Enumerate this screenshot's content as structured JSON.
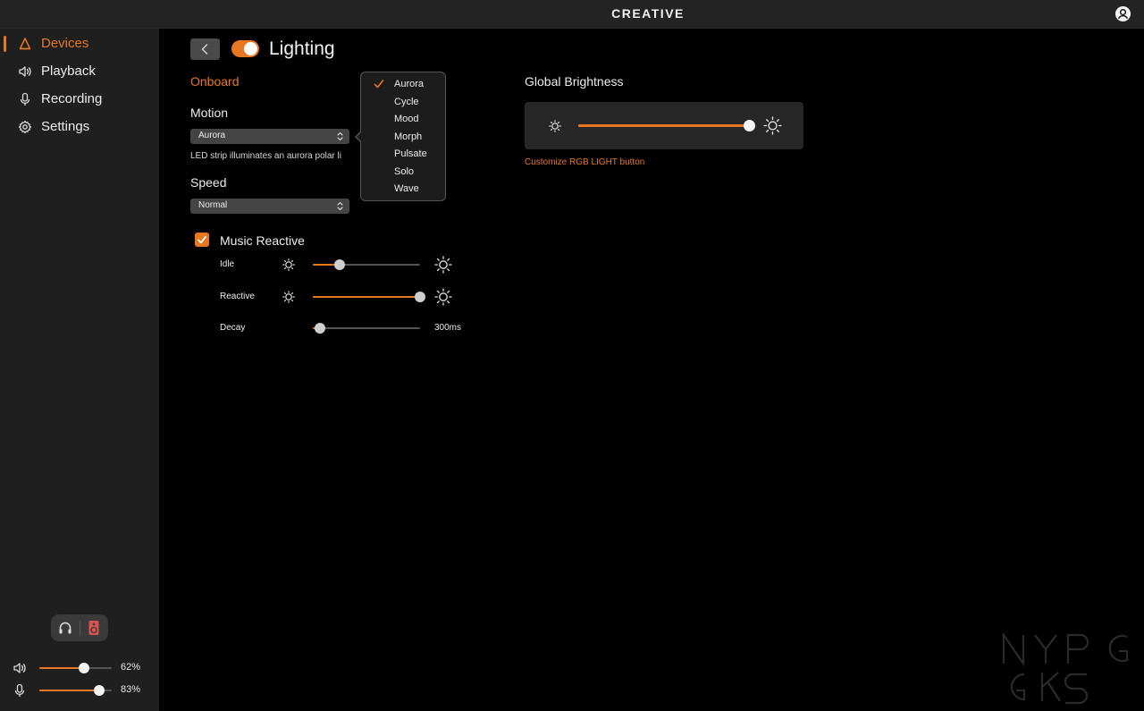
{
  "header": {
    "brand": "CREATIVE",
    "account_icon": "user-circle-icon"
  },
  "sidebar": {
    "items": [
      {
        "label": "Devices",
        "icon": "device-triangle-icon",
        "active": true
      },
      {
        "label": "Playback",
        "icon": "speaker-icon",
        "active": false
      },
      {
        "label": "Recording",
        "icon": "microphone-icon",
        "active": false
      },
      {
        "label": "Settings",
        "icon": "gear-icon",
        "active": false
      }
    ],
    "output_toggle": {
      "options": [
        "headphones-icon",
        "speaker-box-icon"
      ]
    },
    "volume": {
      "speaker": {
        "value": 62,
        "label": "62%"
      },
      "mic": {
        "value": 83,
        "label": "83%"
      }
    }
  },
  "main": {
    "title": "Lighting",
    "enabled": true,
    "section": "Onboard",
    "motion": {
      "label": "Motion",
      "selected": "Aurora",
      "description": "LED strip illuminates an aurora polar li",
      "options": [
        "Aurora",
        "Cycle",
        "Mood",
        "Morph",
        "Pulsate",
        "Solo",
        "Wave"
      ]
    },
    "speed": {
      "label": "Speed",
      "selected": "Normal"
    },
    "music_reactive": {
      "label": "Music Reactive",
      "checked": true,
      "idle": {
        "label": "Idle",
        "value": 0.25
      },
      "reactive": {
        "label": "Reactive",
        "value": 1.0
      },
      "decay": {
        "label": "Decay",
        "value": 0.07,
        "readout": "300ms"
      }
    },
    "global_brightness": {
      "label": "Global Brightness",
      "value": 1.0,
      "link": "Customize RGB LIGHT button"
    }
  },
  "colors": {
    "accent": "#e87722",
    "panel": "#272727",
    "sidebar": "#1f1f1f"
  },
  "watermark": {
    "text": "NYPGKS"
  }
}
